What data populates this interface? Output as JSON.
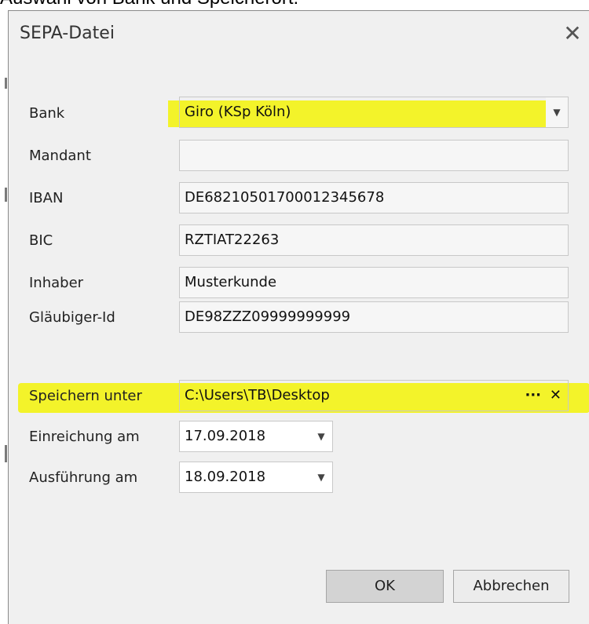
{
  "caption": "Auswahl von Bank und Speicherort:",
  "dialog": {
    "title": "SEPA-Datei",
    "close_icon": "close-icon"
  },
  "form": {
    "bank": {
      "label": "Bank",
      "value": "Giro (KSp Köln)"
    },
    "mandant": {
      "label": "Mandant",
      "value": ""
    },
    "iban": {
      "label": "IBAN",
      "value": "DE68210501700012345678"
    },
    "bic": {
      "label": "BIC",
      "value": "RZTIAT22263"
    },
    "inhaber": {
      "label": "Inhaber",
      "value": "Musterkunde"
    },
    "glaeubiger": {
      "label": "Gläubiger-Id",
      "value": "DE98ZZZ09999999999"
    },
    "speichern": {
      "label": "Speichern unter",
      "value": "C:\\Users\\TB\\Desktop",
      "browse": "···",
      "clear": "✕"
    },
    "einreichung": {
      "label": "Einreichung am",
      "value": "17.09.2018"
    },
    "ausfuehrung": {
      "label": "Ausführung am",
      "value": "18.09.2018"
    }
  },
  "buttons": {
    "ok": "OK",
    "cancel": "Abbrechen"
  },
  "colors": {
    "highlight": "#f3f32a",
    "dialog_bg": "#f0f0f0"
  }
}
